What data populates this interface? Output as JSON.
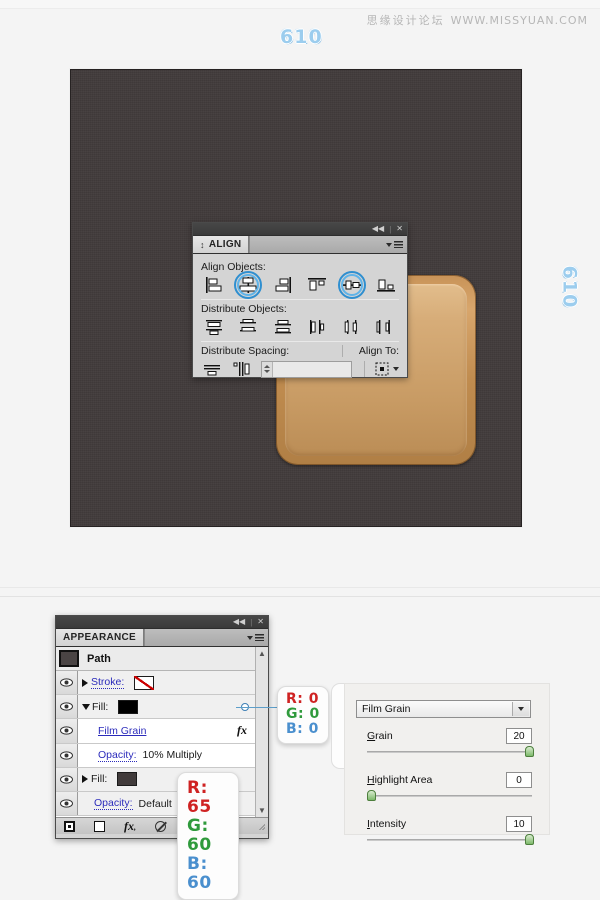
{
  "watermark": {
    "cn": "思缘设计论坛",
    "url": "WWW.MISSYUAN.COM"
  },
  "markers": {
    "top": "610",
    "right": "610"
  },
  "align_panel": {
    "title": "ALIGN",
    "titlebar": {
      "collapse": "◀◀",
      "separator": "|",
      "close": "✕"
    },
    "sections": {
      "align_objects": "Align Objects:",
      "distribute_objects": "Distribute Objects:",
      "distribute_spacing": "Distribute Spacing:",
      "align_to": "Align To:"
    },
    "align_objects_icons": [
      "horizontal-align-left-icon",
      "horizontal-align-center-icon",
      "horizontal-align-right-icon",
      "vertical-align-top-icon",
      "vertical-align-center-icon",
      "vertical-align-bottom-icon"
    ],
    "highlighted_icons": [
      "horizontal-align-center-icon",
      "vertical-align-center-icon"
    ],
    "distribute_objects_icons": [
      "vertical-distribute-top-icon",
      "vertical-distribute-center-icon",
      "vertical-distribute-bottom-icon",
      "horizontal-distribute-left-icon",
      "horizontal-distribute-center-icon",
      "horizontal-distribute-right-icon"
    ],
    "distribute_spacing_icons": [
      "vertical-distribute-space-icon",
      "horizontal-distribute-space-icon"
    ],
    "spacing_value": "",
    "align_to_value": "align-to-selection-icon",
    "highlight_color": "#2f8fd0"
  },
  "appearance_panel": {
    "title": "APPEARANCE",
    "titlebar": {
      "collapse": "◀◀",
      "separator": "|",
      "close": "✕"
    },
    "object_name": "Path",
    "rows": [
      {
        "label": "Stroke:",
        "value": "",
        "swatch": "none",
        "type": "stroke"
      },
      {
        "label": "Fill:",
        "value": "",
        "swatch": "#000000",
        "type": "fill"
      },
      {
        "label": "Film Grain",
        "value": "",
        "swatch": "",
        "type": "effect"
      },
      {
        "label": "Opacity:",
        "value": "10% Multiply",
        "swatch": "",
        "type": "opacity"
      },
      {
        "label": "Fill:",
        "value": "",
        "swatch": "#413b3b",
        "type": "fill"
      },
      {
        "label": "Opacity:",
        "value": "Default",
        "swatch": "",
        "type": "opacity"
      }
    ],
    "footer_icons": [
      "add-new-stroke-icon",
      "add-new-fill-icon",
      "add-new-effect-icon",
      "clear-appearance-icon",
      "resize-grip-icon"
    ]
  },
  "callouts": {
    "black_fill": {
      "r": "R: 0",
      "g": "G: 0",
      "b": "B: 0"
    },
    "dark_fill": {
      "r": "R: 65",
      "g": "G: 60",
      "b": "B: 60"
    }
  },
  "film_grain_dialog": {
    "effect_name": "Film Grain",
    "controls": [
      {
        "label": "Grain",
        "accesskey": "G",
        "value": "20",
        "position_pct": 98
      },
      {
        "label": "Highlight Area",
        "accesskey": "H",
        "value": "0",
        "position_pct": 2
      },
      {
        "label": "Intensity",
        "accesskey": "I",
        "value": "10",
        "position_pct": 98
      }
    ]
  },
  "colors": {
    "page_bg": "#f4f4f4",
    "artboard": "#413b3b",
    "plaque_wood": "#c89358",
    "marker": "#9ccdee",
    "accent_blue": "#2f8fd0"
  }
}
